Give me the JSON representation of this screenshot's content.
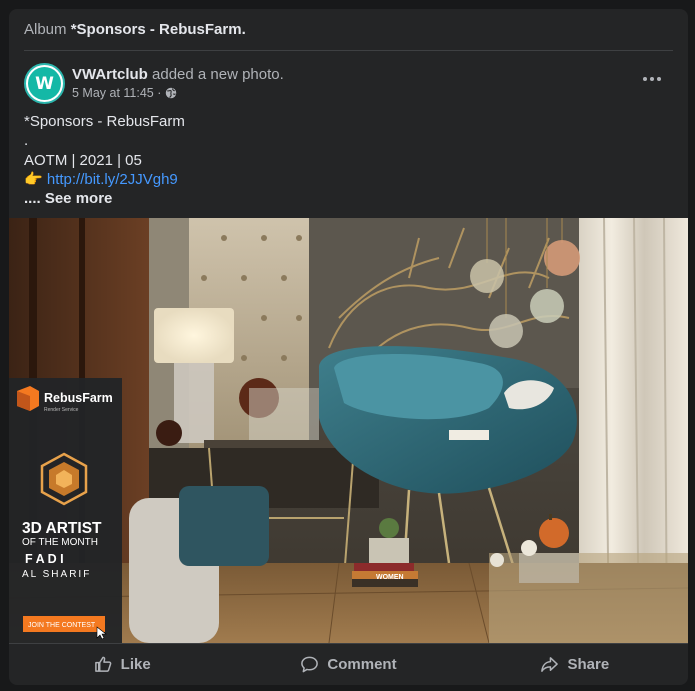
{
  "album": {
    "prefix": "Album",
    "title": "*Sponsors - RebusFarm."
  },
  "post": {
    "author": "VWArtclub",
    "action": "added a new photo.",
    "timestamp": "5 May at 11:45 ·",
    "avatar_letter": "W",
    "privacy_icon": "globe-icon",
    "caption": {
      "line1": "*Sponsors - RebusFarm",
      "line2": ".",
      "line3": "AOTM | 2021 | 05",
      "pointer_emoji": "👉",
      "link": "http://bit.ly/2JJVgh9",
      "see_more": ".... See more"
    }
  },
  "photo": {
    "banner": {
      "brand": "RebusFarm",
      "brand_sub": "Render Service",
      "headline1": "3D ARTIST",
      "headline2": "OF THE MONTH",
      "name1": "F A D I",
      "name2": "AL SHARIF",
      "cta": "JOIN THE CONTEST"
    },
    "book_label": "WOMEN"
  },
  "actions": {
    "like": "Like",
    "comment": "Comment",
    "share": "Share"
  },
  "colors": {
    "card": "#242526",
    "link": "#4599ff",
    "accent_orange": "#f47920",
    "avatar_teal": "#14b8a6"
  }
}
